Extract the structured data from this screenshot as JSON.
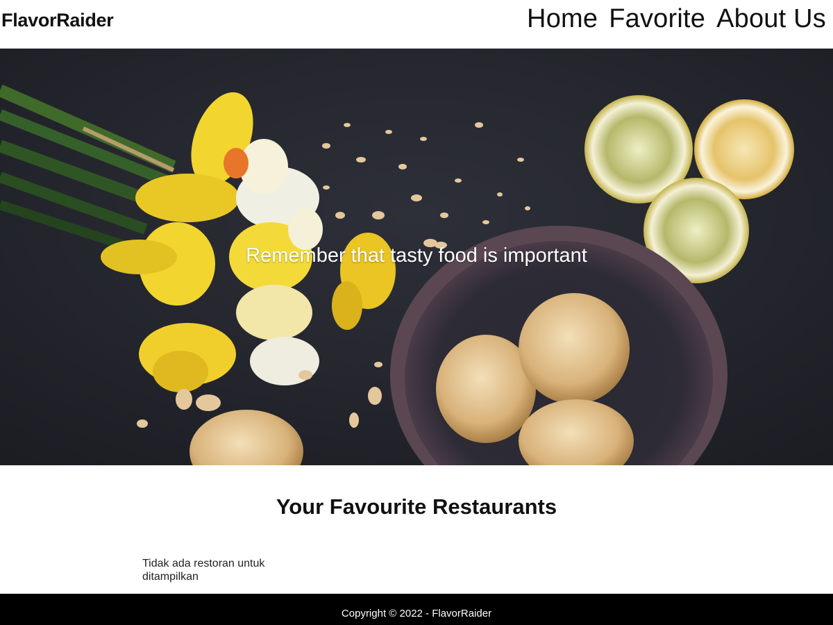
{
  "header": {
    "brand": "FlavorRaider",
    "nav": [
      {
        "label": "Home"
      },
      {
        "label": "Favorite"
      },
      {
        "label": "About Us"
      }
    ]
  },
  "hero": {
    "tagline": "Remember that tasty food is important"
  },
  "main": {
    "title": "Your Favourite Restaurants",
    "empty_message": "Tidak ada restoran untuk ditampilkan"
  },
  "footer": {
    "copyright": "Copyright © 2022 - FlavorRaider"
  },
  "colors": {
    "header_bg": "#ffffff",
    "hero_bg": "#23242b",
    "footer_bg": "#000000",
    "text_light": "#ffffff"
  }
}
